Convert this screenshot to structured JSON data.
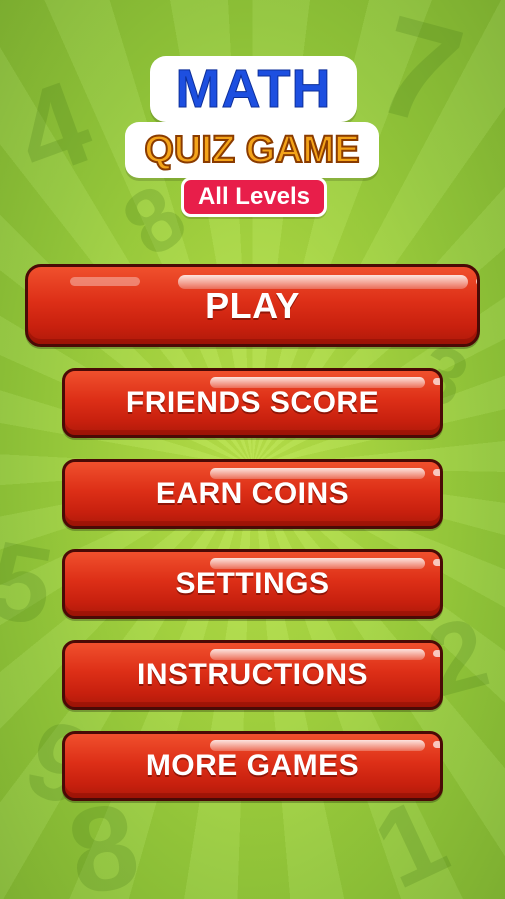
{
  "logo": {
    "line1": "MATH",
    "line2": "QUIZ GAME",
    "line3": "All Levels"
  },
  "menu": {
    "play": "PLAY",
    "friends_score": "FRIENDS SCORE",
    "earn_coins": "EARN COINS",
    "settings": "SETTINGS",
    "instructions": "INSTRUCTIONS",
    "more_games": "MORE GAMES"
  },
  "colors": {
    "background": "#a6d640",
    "button": "#dd2f17",
    "button_border": "#4a0a06",
    "math_text": "#1d4fe0",
    "quiz_text": "#f4a41a",
    "levels_badge": "#e81e4a"
  }
}
